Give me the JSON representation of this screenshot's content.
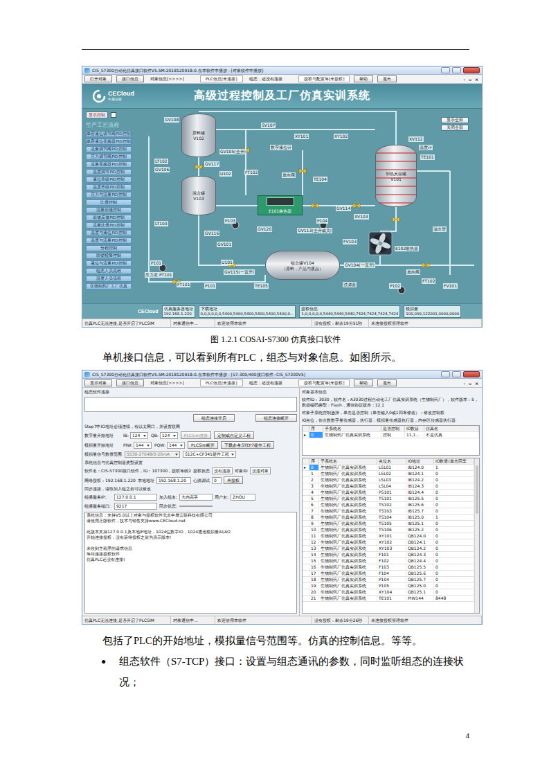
{
  "document": {
    "caption": "图 1.2.1 COSAI-S7300 仿真接口软件",
    "paragraph1": "单机接口信息，可以看到所有PLC，组态与对象信息。如图所示。",
    "paragraph2": "包括了PLC的开始地址，模拟量信号范围等。仿真的控制信息。等等。",
    "bullets": [
      {
        "marker": "●",
        "text": "组态软件（S7-TCP）接口：设置与组态通讯的参数，同时监听组态的连接状况；"
      }
    ],
    "page_number": "4"
  },
  "window1": {
    "title": "CIS_S7300自动化仿真接口软件V5.5M:2018120918:0.在本软件中播放 - [对象软件中播放]",
    "mdi_controls": [
      "-",
      "▫",
      "×"
    ],
    "toolbar": [
      {
        "label": "打开对象",
        "kind": "button"
      },
      {
        "label": "接口信息",
        "kind": "button"
      },
      {
        "label": "对象信息[>>>>]",
        "kind": "text"
      },
      {
        "label": "PLC信息[未连接]",
        "kind": "field"
      },
      {
        "label": "组态，还没有连接",
        "kind": "text"
      },
      {
        "label": "授权与配置等[未授权]",
        "kind": "field"
      },
      {
        "label": "帮助",
        "kind": "button"
      },
      {
        "label": "退出",
        "kind": "button"
      }
    ],
    "header": {
      "logo": "CECloud",
      "logo_sub": "中晟云联",
      "title": "高级过程控制及工厂仿真实训系统"
    },
    "sidebar": {
      "toggle": {
        "label": "显示控制",
        "checked": false
      },
      "section": "生产工艺流程",
      "items": [
        "单容液位调节阀PID控制",
        "单容液位变频器PID控制",
        "流量调节阀PID控制",
        "压力调节阀PID控制",
        "流量变频器PID控制",
        "温度调节PID控制",
        "液位串级PID控制",
        "温度串级PID控制",
        "压力与流量PID控制",
        "比值控制",
        "流量前馈控制",
        "前馈反馈PID控制",
        "流量比值PID控制",
        "温度与液位PID控制",
        "温度与流量PID控制",
        "分程控制",
        "联锁报警控制",
        "液位与流量PID控制",
        "组态人员流程",
        "温度人员流程",
        "生物制药厂工厂仿真"
      ]
    },
    "top_right_buttons": [
      "显示全部",
      "关闭全部"
    ],
    "equipment": [
      {
        "kind": "tank",
        "lines": [
          "原料罐",
          "V102"
        ]
      },
      {
        "kind": "tank",
        "lines": [
          "混合罐",
          "V103"
        ]
      },
      {
        "kind": "reactor",
        "lines": [
          "加热反应罐",
          "V101"
        ]
      },
      {
        "kind": "drum",
        "lines": [
          "组合罐V104",
          "（原料，产品与废品）"
        ]
      },
      {
        "kind": "exchanger",
        "lines": [
          "E101换热器"
        ]
      },
      {
        "kind": "fan",
        "lines": []
      },
      {
        "kind": "tag",
        "lines": [
          "GV108"
        ]
      },
      {
        "kind": "tag",
        "lines": [
          "SV107"
        ]
      },
      {
        "kind": "tag",
        "lines": [
          "XY101"
        ]
      },
      {
        "kind": "tag",
        "lines": [
          "XY102"
        ]
      },
      {
        "kind": "tag",
        "lines": [
          "XV112"
        ]
      },
      {
        "kind": "tag",
        "lines": [
          "温度计"
        ]
      },
      {
        "kind": "tag",
        "lines": [
          "TE101"
        ]
      },
      {
        "kind": "tag",
        "lines": [
          "数字液位计"
        ]
      },
      {
        "kind": "tag",
        "lines": [
          "GV105(全开)"
        ]
      },
      {
        "kind": "tag",
        "lines": [
          "GV117"
        ]
      },
      {
        "kind": "tag",
        "lines": [
          "LT102"
        ]
      },
      {
        "kind": "tag",
        "lines": [
          "GV106"
        ]
      },
      {
        "kind": "tag",
        "lines": [
          "FT102"
        ]
      },
      {
        "kind": "tag",
        "lines": [
          "单向阀"
        ]
      },
      {
        "kind": "tag",
        "lines": [
          "U102"
        ]
      },
      {
        "kind": "tag",
        "lines": [
          "TE104"
        ]
      },
      {
        "kind": "tag",
        "lines": [
          "P103"
        ]
      },
      {
        "kind": "tag",
        "lines": [
          "P104"
        ]
      },
      {
        "kind": "tag",
        "lines": [
          "GV114"
        ]
      },
      {
        "kind": "tag",
        "lines": [
          "XV103"
        ]
      },
      {
        "kind": "tag",
        "lines": [
          "GV113(全开或关)"
        ]
      },
      {
        "kind": "tag",
        "lines": [
          "GV120"
        ]
      },
      {
        "kind": "tag",
        "lines": [
          "GV116"
        ]
      },
      {
        "kind": "tag",
        "lines": [
          "LT103"
        ]
      },
      {
        "kind": "tag",
        "lines": [
          "FV103"
        ]
      },
      {
        "kind": "tag",
        "lines": [
          "溢出管"
        ]
      },
      {
        "kind": "tag",
        "lines": [
          "GV101"
        ]
      },
      {
        "kind": "tag",
        "lines": [
          "E102散热器"
        ]
      },
      {
        "kind": "tag",
        "lines": [
          "U101"
        ]
      },
      {
        "kind": "tag",
        "lines": [
          "GV115(一直开)"
        ]
      },
      {
        "kind": "tag",
        "lines": [
          "P101"
        ]
      },
      {
        "kind": "tag",
        "lines": [
          "压力表 PT101"
        ]
      },
      {
        "kind": "tag",
        "lines": [
          "FT101"
        ]
      },
      {
        "kind": "tag",
        "lines": [
          "P101"
        ]
      },
      {
        "kind": "tag",
        "lines": [
          "TE105"
        ]
      },
      {
        "kind": "tag",
        "lines": [
          "GV104(一直开)"
        ]
      },
      {
        "kind": "tag",
        "lines": [
          "过滤器"
        ]
      },
      {
        "kind": "tag",
        "lines": [
          "P102"
        ]
      },
      {
        "kind": "tag",
        "lines": [
          "单向阀"
        ]
      },
      {
        "kind": "tag",
        "lines": [
          "FT102"
        ]
      },
      {
        "kind": "tag",
        "lines": [
          "FV101"
        ]
      }
    ],
    "info_strip": {
      "logo": "CECloud",
      "boxes": [
        {
          "lines": [
            "仿真服务器地址",
            "192.168.1.220"
          ]
        },
        {
          "lines": [
            "下载地址",
            "0,0,0,0,0,0,5400,5400,5400,5400,5400,5400,0..."
          ]
        },
        {
          "lines": [
            "授权信息",
            "1,0,0,0,0,0,5440,5440,5440,7424,7424,7424,7424"
          ]
        },
        {
          "lines": [
            "模拟量",
            "100,099,122001,0000,0000"
          ]
        }
      ]
    },
    "status_bar": [
      "仿真PLC无法连接,是否开启了PLCSIM",
      "对象通信中...",
      "欢迎使用本软件",
      "没有授权：剩余19分51秒",
      "未连接授权管理软件"
    ]
  },
  "window2": {
    "title": "CIS_S7300自动化仿真接口软件V5.5M:2018120918:0.在本软件中播放 - [S7-300/400接口软件--CIS_S7300V5]",
    "mdi_controls": [
      "-",
      "▫",
      "×"
    ],
    "toolbar": [
      {
        "label": "显示对象",
        "kind": "button"
      },
      {
        "label": "接口信息",
        "kind": "button"
      },
      {
        "label": "对象信息[>>>>]",
        "kind": "text"
      },
      {
        "label": "PLC信息[未连接]",
        "kind": "field"
      },
      {
        "label": "组态，还没有连接",
        "kind": "text"
      },
      {
        "label": "授权与配置等[未授权]",
        "kind": "field"
      },
      {
        "label": "帮助",
        "kind": "button"
      },
      {
        "label": "退出",
        "kind": "button"
      }
    ],
    "left": {
      "section_title": "组态软件连接",
      "connect_buttons": [
        "组态连接开启",
        "组态连接断开"
      ],
      "note": "Step7中IO地址必须连续，有以太网口，并设置联网",
      "digital": {
        "label": "数字量开始地址",
        "fields": [
          {
            "label": "IB:",
            "value": "124"
          },
          {
            "label": "QB:",
            "value": "124"
          }
        ],
        "button": {
          "label": "PLCSim连接",
          "disabled": true
        },
        "link": "定制或自定义工程"
      },
      "analog": {
        "label": "模拟量开始地址",
        "fields": [
          {
            "label": "PIW:",
            "value": "144"
          },
          {
            "label": "PQW:",
            "value": "144"
          }
        ],
        "button": {
          "label": "PLCSim断开",
          "disabled": false
        },
        "link": "下载参考STEP7硬件工程"
      },
      "range": {
        "label": "模拟量信号数值范围",
        "value": "5530-27648/0-20mA",
        "link": "S12C+CP341硬件工程"
      },
      "system_title": "系统信息与仿真控制器类型设置",
      "software": {
        "text": "软件名：CIS-S7300接口软件，ID：107300，授权等级2",
        "auth_label": "授权状态",
        "auth_value": "没有连接",
        "object_label": "对象ID",
        "object_value": "没连对象"
      },
      "network": {
        "label": "网络授权：192.168.1.220",
        "local_label": "本地地址",
        "local_value": "192.168.1.20",
        "heartbeat_label": "心跳调试",
        "heartbeat_value": "0",
        "button": "再授权"
      },
      "sync_title": "同步连接，读取加入组之前可以修改",
      "multicast": {
        "ip_label": "组播服务IP:",
        "ip": "127.0.0.1",
        "group_label": "加入组名:",
        "group": "大内高手",
        "user_label": "用户名:",
        "user": "ZHOU",
        "port_label": "组播服务端口:",
        "port": "9217",
        "sync_label": "同步状态:"
      },
      "log": [
        {
          "text": "系统信息：支持V5.0以上对象与授权软件北京中晟云联科技有限公司",
          "gap": false
        },
        {
          "text": "请使用正版软件，技术与销售支持www.CECloud.net",
          "gap": false
        },
        {
          "text": "此版本支持127.0.0.1及本地IP地址，1024位数字IO，1024通道模拟量AI/AO",
          "gap": true
        },
        {
          "text": "开始连接授权，没有获得授权之前为演示版本!",
          "gap": false
        },
        {
          "text": "未收到主程序的请求信息",
          "gap": true
        },
        {
          "text": "等待连接授权软件",
          "gap": false
        },
        {
          "text": "仿真PLC还没有连接(",
          "gap": false
        }
      ]
    },
    "right": {
      "section_title": "对象基本信息",
      "info": [
        "软件ID：3030，软件名：A3030过程自动化工厂仿真实训系统（生物制药厂），软件版本：5，数据编码类型：Flash，通信协议版本：12.1",
        "对象子系统控制选择，单击是否控制（单击输入0或1回车修改）；修改控制权",
        "IO点位，你次数数字量传感器，执行器，模拟量传感器执行器，内存区传感器执行器"
      ],
      "marker": "▸",
      "subsystem_table": {
        "columns": [
          "序",
          "子系统名",
          "是否控制",
          "IO数目",
          "仿真名"
        ],
        "rows": [
          {
            "cells": [
              "0",
              "生物制药厂仿真实训系统",
              "控制",
              "11,1...",
              "不是仿真"
            ],
            "selected": true
          }
        ]
      },
      "points_table": {
        "columns": [
          "序",
          "子系统名",
          "点位名",
          "IO地址",
          "IO数值(单击回车"
        ],
        "rows": [
          {
            "cells": [
              "0",
              "生物制药厂仿真实训系统",
              "LSL01",
              "IB124.0",
              "1"
            ],
            "selected": true
          },
          {
            "cells": [
              "1",
              "生物制药厂仿真实训系统",
              "LSL02",
              "IB124.1",
              "0"
            ],
            "selected": false
          },
          {
            "cells": [
              "2",
              "生物制药厂仿真实训系统",
              "LSL03",
              "IB124.2",
              "0"
            ],
            "selected": false
          },
          {
            "cells": [
              "3",
              "生物制药厂仿真实训系统",
              "LSL04",
              "IB124.3",
              "0"
            ],
            "selected": false
          },
          {
            "cells": [
              "4",
              "生物制药厂仿真实训系统",
              "PS101",
              "IB124.4",
              "0"
            ],
            "selected": false
          },
          {
            "cells": [
              "5",
              "生物制药厂仿真实训系统",
              "TS101",
              "IB125.5",
              "0"
            ],
            "selected": false
          },
          {
            "cells": [
              "6",
              "生物制药厂仿真实训系统",
              "TS102",
              "IB125.6",
              "0"
            ],
            "selected": false
          },
          {
            "cells": [
              "7",
              "生物制药厂仿真实训系统",
              "TS103",
              "IB125.7",
              "0"
            ],
            "selected": false
          },
          {
            "cells": [
              "8",
              "生物制药厂仿真实训系统",
              "TS104",
              "IB125.0",
              "1"
            ],
            "selected": false
          },
          {
            "cells": [
              "9",
              "生物制药厂仿真实训系统",
              "TS105",
              "IB125.1",
              "0"
            ],
            "selected": false
          },
          {
            "cells": [
              "10",
              "生物制药厂仿真实训系统",
              "TS106",
              "IB125.2",
              "0"
            ],
            "selected": false
          },
          {
            "cells": [
              "11",
              "生物制药厂仿真实训系统",
              "XY101",
              "QB124.0",
              "0"
            ],
            "selected": false
          },
          {
            "cells": [
              "12",
              "生物制药厂仿真实训系统",
              "XY102",
              "QB124.1",
              "0"
            ],
            "selected": false
          },
          {
            "cells": [
              "13",
              "生物制药厂仿真实训系统",
              "XY103",
              "QB124.2",
              "0"
            ],
            "selected": false
          },
          {
            "cells": [
              "14",
              "生物制药厂仿真实训系统",
              "F101",
              "QB124.3",
              "0"
            ],
            "selected": false
          },
          {
            "cells": [
              "15",
              "生物制药厂仿真实训系统",
              "F102",
              "QB124.4",
              "0"
            ],
            "selected": false
          },
          {
            "cells": [
              "16",
              "生物制药厂仿真实训系统",
              "F103",
              "QB125.5",
              "0"
            ],
            "selected": false
          },
          {
            "cells": [
              "17",
              "生物制药厂仿真实训系统",
              "F104",
              "QB125.6",
              "0"
            ],
            "selected": false
          },
          {
            "cells": [
              "18",
              "生物制药厂仿真实训系统",
              "P104",
              "QB125.7",
              "0"
            ],
            "selected": false
          },
          {
            "cells": [
              "19",
              "生物制药厂仿真实训系统",
              "P105",
              "QB125.0",
              "0"
            ],
            "selected": false
          },
          {
            "cells": [
              "20",
              "生物制药厂仿真实训系统",
              "XY104",
              "QB125.1",
              "0"
            ],
            "selected": false
          },
          {
            "cells": [
              "21",
              "生物制药厂仿真实训系统",
              "TE101",
              "PIW144",
              "8448"
            ],
            "selected": false
          }
        ]
      }
    },
    "status_bar": [
      "仿真PLC无法连接,是否开启了PLCSIM",
      "对象通信中...",
      "欢迎使用本软件",
      "没有授权：剩余19分26秒",
      "未连接授权管理软件"
    ]
  }
}
